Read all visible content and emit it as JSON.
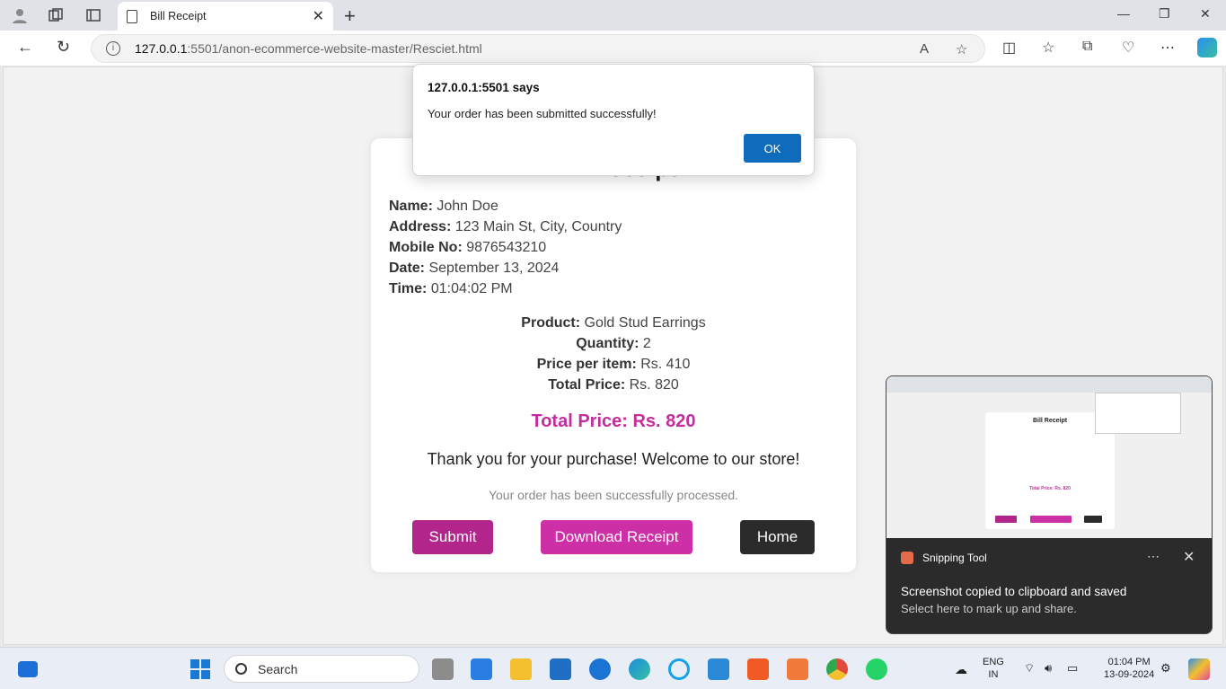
{
  "browser": {
    "tab_title": "Bill Receipt",
    "url_host": "127.0.0.1",
    "url_path": ":5501/anon-ecommerce-website-master/Resciet.html"
  },
  "receipt": {
    "title": "Bill Receipt",
    "name_label": "Name:",
    "name_value": " John Doe",
    "address_label": "Address:",
    "address_value": " 123 Main St, City, Country",
    "mobile_label": "Mobile No:",
    "mobile_value": " 9876543210",
    "date_label": "Date:",
    "date_value": " September 13, 2024",
    "time_label": "Time:",
    "time_value": " 01:04:02 PM",
    "product_label": "Product:",
    "product_value": " Gold Stud Earrings",
    "quantity_label": "Quantity:",
    "quantity_value": " 2",
    "price_label": "Price per item:",
    "price_value": " Rs. 410",
    "total_label": "Total Price:",
    "total_value": " Rs. 820",
    "total_big": "Total Price: Rs. 820",
    "thanks": "Thank you for your purchase! Welcome to our store!",
    "processed": "Your order has been successfully processed.",
    "submit_label": "Submit",
    "download_label": "Download Receipt",
    "home_label": "Home"
  },
  "dialog": {
    "title": "127.0.0.1:5501 says",
    "message": "Your order has been submitted successfully!",
    "ok_label": "OK"
  },
  "notification": {
    "app_name": "Snipping Tool",
    "heading": "Screenshot copied to clipboard and saved",
    "body": "Select here to mark up and share.",
    "thumb_title": "Bill Receipt",
    "thumb_total": "Total Price: Rs. 820"
  },
  "taskbar": {
    "search_placeholder": "Search",
    "lang_line1": "ENG",
    "lang_line2": "IN",
    "time": "01:04 PM",
    "date": "13-09-2024"
  },
  "colors": {
    "accent": "#cc2fa6",
    "submit": "#b2268c",
    "home": "#2b2b2b",
    "dialog_ok": "#0f6cbd"
  }
}
